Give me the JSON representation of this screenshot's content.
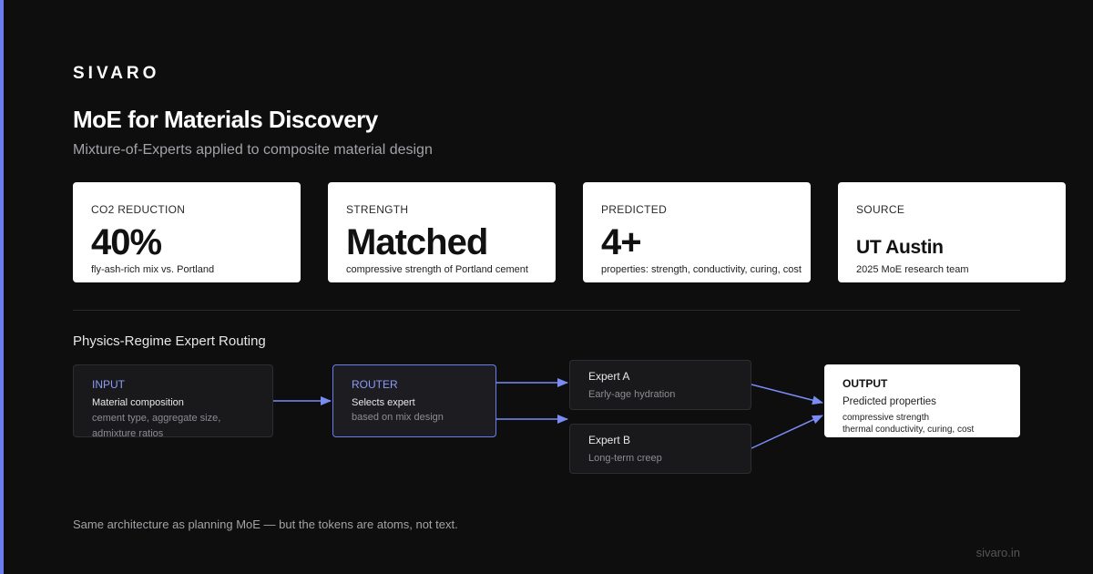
{
  "brand": "SIVARO",
  "title": "MoE for Materials Discovery",
  "subtitle": "Mixture-of-Experts applied to composite material design",
  "colors": {
    "accent": "#6b7ef0",
    "background": "#0e0e0f",
    "card": "#ffffff"
  },
  "stats": [
    {
      "label": "CO2 REDUCTION",
      "value": "40%",
      "desc": "fly-ash-rich mix vs. Portland"
    },
    {
      "label": "STRENGTH",
      "value": "Matched",
      "desc": "compressive strength of Portland cement"
    },
    {
      "label": "PREDICTED",
      "value": "4+",
      "desc": "properties: strength, conductivity, curing, cost"
    },
    {
      "label": "SOURCE",
      "value": "UT Austin",
      "desc": "2025 MoE research team"
    }
  ],
  "routing": {
    "title": "Physics-Regime Expert Routing",
    "input": {
      "head": "INPUT",
      "line1": "Material composition",
      "line2": "cement type, aggregate size,",
      "line3": "admixture ratios"
    },
    "router": {
      "head": "ROUTER",
      "line1": "Selects expert",
      "line2": "based on mix design"
    },
    "expert_a": {
      "head": "Expert A",
      "line1": "Early-age hydration"
    },
    "expert_b": {
      "head": "Expert B",
      "line1": "Long-term creep"
    },
    "output": {
      "head": "OUTPUT",
      "line1": "Predicted properties",
      "line2": "compressive strength",
      "line3": "thermal conductivity, curing, cost"
    }
  },
  "footer_note": "Same architecture as planning MoE — but the tokens are atoms, not text.",
  "site": "sivaro.in"
}
